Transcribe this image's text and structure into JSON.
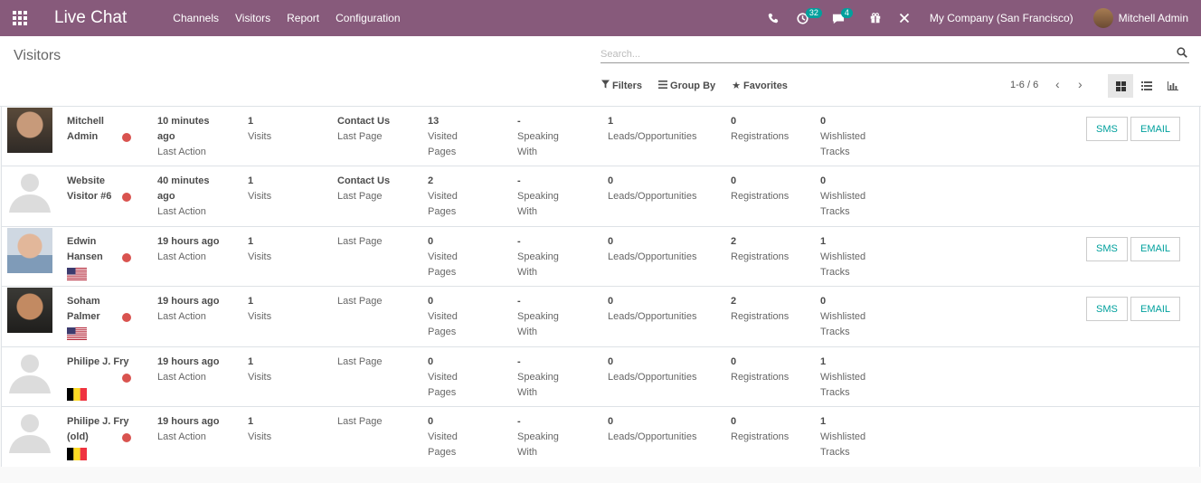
{
  "navbar": {
    "brand": "Live Chat",
    "menu": [
      "Channels",
      "Visitors",
      "Report",
      "Configuration"
    ],
    "activity_count": "32",
    "messages_count": "4",
    "company": "My Company (San Francisco)",
    "user": "Mitchell Admin"
  },
  "control": {
    "breadcrumb": "Visitors",
    "search_placeholder": "Search...",
    "filters_label": "Filters",
    "groupby_label": "Group By",
    "favorites_label": "Favorites",
    "pager": "1-6 / 6"
  },
  "labels": {
    "last_action": "Last Action",
    "visits": "Visits",
    "last_page": "Last Page",
    "visited": "Visited",
    "pages": "Pages",
    "speaking": "Speaking",
    "with": "With",
    "leads": "Leads/Opportunities",
    "registrations": "Registrations",
    "wishlisted": "Wishlisted",
    "tracks": "Tracks",
    "sms": "SMS",
    "email": "EMAIL"
  },
  "visitors": [
    {
      "name1": "Mitchell",
      "name2": "Admin",
      "time1": "10 minutes",
      "time2": "ago",
      "visits": "1",
      "page": "Contact Us",
      "visited": "13",
      "speaking": "-",
      "leads": "1",
      "registrations": "0",
      "tracks": "0"
    },
    {
      "name1": "Website",
      "name2": "Visitor #6",
      "time1": "40 minutes",
      "time2": "ago",
      "visits": "1",
      "page": "Contact Us",
      "visited": "2",
      "speaking": "-",
      "leads": "0",
      "registrations": "0",
      "tracks": "0"
    },
    {
      "name1": "Edwin",
      "name2": "Hansen",
      "time1": "19 hours ago",
      "time2": "",
      "visits": "1",
      "page": "",
      "visited": "0",
      "speaking": "-",
      "leads": "0",
      "registrations": "2",
      "tracks": "1"
    },
    {
      "name1": "Soham",
      "name2": "Palmer",
      "time1": "19 hours ago",
      "time2": "",
      "visits": "1",
      "page": "",
      "visited": "0",
      "speaking": "-",
      "leads": "0",
      "registrations": "2",
      "tracks": "0"
    },
    {
      "name1": "Philipe J. Fry",
      "name2": "",
      "time1": "19 hours ago",
      "time2": "",
      "visits": "1",
      "page": "",
      "visited": "0",
      "speaking": "-",
      "leads": "0",
      "registrations": "0",
      "tracks": "1"
    },
    {
      "name1": "Philipe J. Fry",
      "name2": "(old)",
      "time1": "19 hours ago",
      "time2": "",
      "visits": "1",
      "page": "",
      "visited": "0",
      "speaking": "-",
      "leads": "0",
      "registrations": "0",
      "tracks": "1"
    }
  ],
  "colors": {
    "navbar": "#875a7b",
    "accent": "#00a09d",
    "status_dot": "#d9534f"
  }
}
